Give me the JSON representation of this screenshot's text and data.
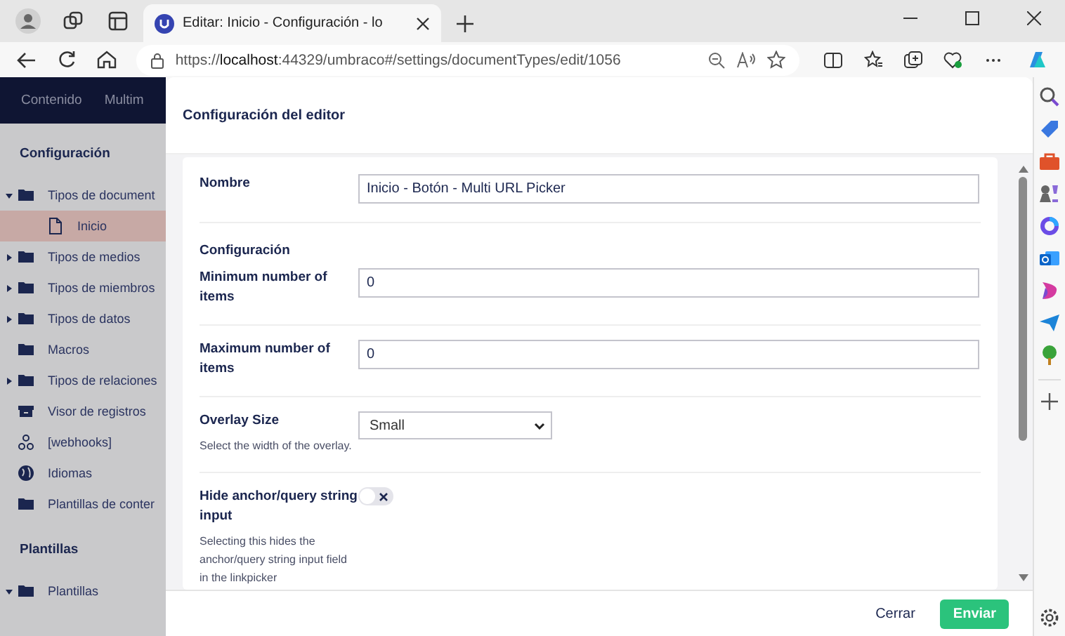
{
  "browser": {
    "tabs": [
      {
        "title": "Editar: Inicio - Configuración - lo",
        "selected": true
      }
    ],
    "url": "https://**localhost**:44329/umbraco#/settings/documentTypes/edit/1056"
  },
  "app": {
    "nav": [
      "Contenido",
      "Multim"
    ],
    "sections": [
      {
        "title": "Configuración",
        "items": [
          {
            "label": "Tipos de document",
            "kind": "folder",
            "expanded": true,
            "children": [
              {
                "label": "Inicio",
                "kind": "document",
                "selected": true
              }
            ]
          },
          {
            "label": "Tipos de medios",
            "kind": "folder",
            "expanded": false
          },
          {
            "label": "Tipos de miembros",
            "kind": "folder",
            "expanded": false
          },
          {
            "label": "Tipos de datos",
            "kind": "folder",
            "expanded": false
          },
          {
            "label": "Macros",
            "kind": "folder"
          },
          {
            "label": "Tipos de relaciones",
            "kind": "folder",
            "expanded": false
          },
          {
            "label": "Visor de registros",
            "kind": "archive"
          },
          {
            "label": "[webhooks]",
            "kind": "network"
          },
          {
            "label": "Idiomas",
            "kind": "globe"
          },
          {
            "label": "Plantillas de conter",
            "kind": "folder"
          }
        ]
      },
      {
        "title": "Plantillas",
        "items": [
          {
            "label": "Plantillas",
            "kind": "folder",
            "expanded": true
          }
        ]
      }
    ]
  },
  "dialog": {
    "title": "Configuración del editor",
    "groups": [
      {
        "fields": [
          {
            "kind": "text",
            "label": "Nombre",
            "value": "Inicio - Botón - Multi URL Picker"
          }
        ]
      },
      {
        "heading": "Configuración",
        "fields": [
          {
            "kind": "text",
            "label": "Minimum number of items",
            "value": "0"
          },
          {
            "kind": "text",
            "label": "Maximum number of items",
            "value": "0"
          },
          {
            "kind": "select",
            "label": "Overlay Size",
            "description": "Select the width of the overlay.",
            "value": "Small"
          },
          {
            "kind": "toggle",
            "label": "Hide anchor/query string input",
            "description": "Selecting this hides the anchor/query string input field in the linkpicker",
            "on": false
          }
        ]
      }
    ],
    "buttons": [
      {
        "label": "Cerrar",
        "kind": "link"
      },
      {
        "label": "Enviar",
        "kind": "primary"
      }
    ]
  }
}
